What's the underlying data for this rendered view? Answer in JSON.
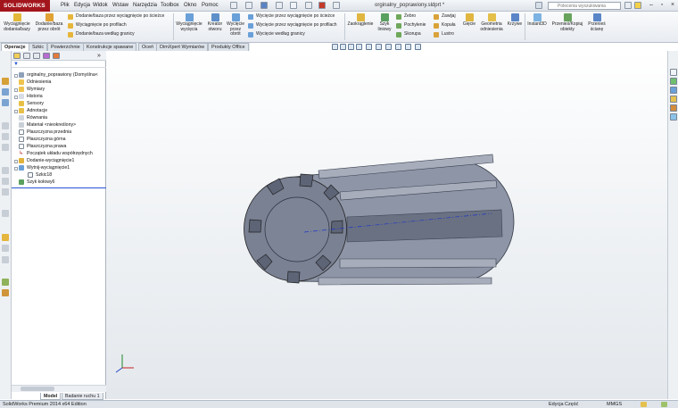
{
  "app": {
    "logo": "SOLIDWORKS",
    "title": "orginalny_poprawiony.sldprt *",
    "search_placeholder": "Polecenia wyszukiwania"
  },
  "menu": [
    "Plik",
    "Edycja",
    "Widok",
    "Wstaw",
    "Narzędzia",
    "Toolbox",
    "Okno",
    "Pomoc"
  ],
  "ribbon": {
    "big": [
      {
        "label": "Wyciągnięcie dodania/bazy",
        "icon": "extrude-boss-icon"
      },
      {
        "label": "Dodanie/baza przez obrót",
        "icon": "revolve-boss-icon"
      },
      {
        "label": "Wyciągnięcie wycięcia",
        "icon": "extrude-cut-icon"
      },
      {
        "label": "Kreator otworu",
        "icon": "hole-wizard-icon"
      },
      {
        "label": "Wycięcie przez obrót",
        "icon": "revolve-cut-icon"
      },
      {
        "label": "Zaokrąglenie",
        "icon": "fillet-icon"
      },
      {
        "label": "Szyk liniowy",
        "icon": "linear-pattern-icon"
      },
      {
        "label": "Żebro",
        "icon": "rib-icon"
      },
      {
        "label": "Geometria odniesienia",
        "icon": "reference-geometry-icon"
      },
      {
        "label": "Krzywe",
        "icon": "curves-icon"
      },
      {
        "label": "Instant3D",
        "icon": "instant3d-icon"
      },
      {
        "label": "Przenieś/Kopiuj obiekty",
        "icon": "move-copy-icon"
      },
      {
        "label": "Przenieś ścianę",
        "icon": "move-face-icon"
      }
    ],
    "small_group1": [
      "Dodanie/baza przez wyciągnięcie po ścieżce",
      "Wyciągnięcie po profilach",
      "Dodanie/baza według granicy"
    ],
    "small_group2": [
      "Wycięcie przez wyciągnięcie po ścieżce",
      "Wycięcie przez wyciągnięcie po profilach",
      "Wycięcie według granicy"
    ],
    "small_group3": [
      "Żebro",
      "Pochylenie",
      "Skorupa"
    ],
    "small_group4": [
      "Zawijaj",
      "Kopuła",
      "Lustro"
    ],
    "giecie": "Gięcie"
  },
  "command_tabs": [
    "Operacje",
    "Szkic",
    "Powierzchnie",
    "Konstrukcje spawane",
    "Oceń",
    "DimXpert Wymiarów",
    "Produkty Office"
  ],
  "tree": [
    {
      "label": "orginalny_poprawiony (Domyślna<",
      "icon": "part-icon",
      "level": 0
    },
    {
      "label": "Odniesienia",
      "icon": "folder-icon",
      "level": 1
    },
    {
      "label": "Wymiary",
      "icon": "folder-icon",
      "level": 1
    },
    {
      "label": "Historia",
      "icon": "history-icon",
      "level": 1
    },
    {
      "label": "Sensory",
      "icon": "sensor-icon",
      "level": 1
    },
    {
      "label": "Adnotacje",
      "icon": "annotation-icon",
      "level": 1
    },
    {
      "label": "Równania",
      "icon": "equation-icon",
      "level": 1
    },
    {
      "label": "Materiał <nieokreślony>",
      "icon": "material-icon",
      "level": 1
    },
    {
      "label": "Płaszczyzna przednia",
      "icon": "plane-icon",
      "level": 1
    },
    {
      "label": "Płaszczyzna górna",
      "icon": "plane-icon",
      "level": 1
    },
    {
      "label": "Płaszczyzna prawa",
      "icon": "plane-icon",
      "level": 1
    },
    {
      "label": "Początek układu współrzędnych",
      "icon": "origin-icon",
      "level": 1
    },
    {
      "label": "Dodanie-wyciągnięcie1",
      "icon": "extrude-icon",
      "level": 1
    },
    {
      "label": "Wytnij-wyciągnięcie1",
      "icon": "cut-icon",
      "level": 1
    },
    {
      "label": "Szkic18",
      "icon": "sketch-icon",
      "level": 2
    },
    {
      "label": "Szyk kołowy6",
      "icon": "circular-pattern-icon",
      "level": 1
    }
  ],
  "bottom_tabs": [
    "Model",
    "Badanie ruchu 1"
  ],
  "status": {
    "left": "SolidWorks Premium 2014 x64 Edition",
    "mid": "Edycja Część",
    "units": "MMGS"
  },
  "colors": {
    "brand": "#a3151c",
    "part": "#8e95a6",
    "part_dark": "#5d6476",
    "rollback": "#2a55d4"
  }
}
